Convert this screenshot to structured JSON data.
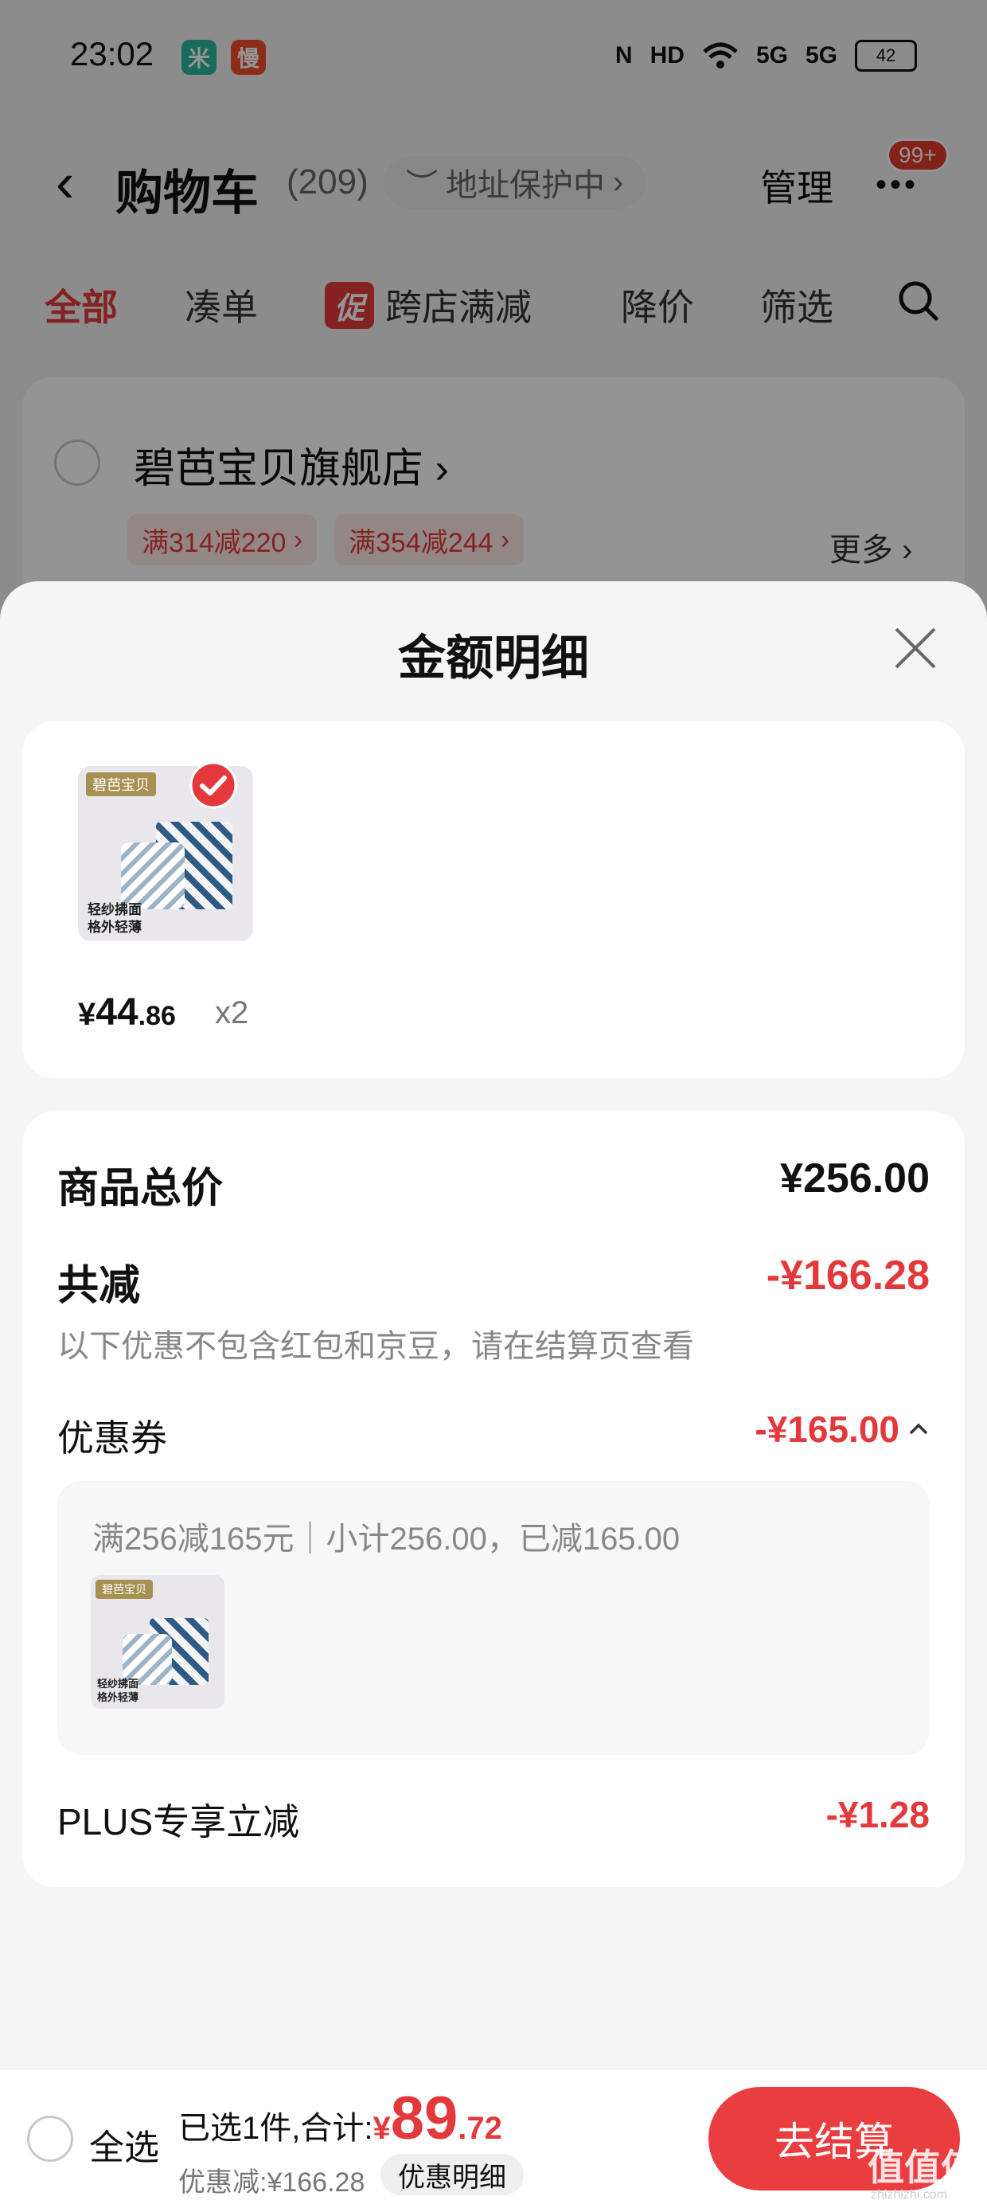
{
  "status_bar": {
    "time": "23:02",
    "app1": "米",
    "app2": "慢",
    "nfc": "N",
    "hd": "HD",
    "signal1": "5G",
    "signal2": "5G",
    "battery": "42"
  },
  "cart_header": {
    "title": "购物车",
    "count": "(209)",
    "address_protection": "地址保护中",
    "manage": "管理",
    "message_badge": "99+"
  },
  "filter_tabs": {
    "all": "全部",
    "coudan": "凑单",
    "promo_chip": "促",
    "cross_store": "跨店满减",
    "price_drop": "降价",
    "filter": "筛选"
  },
  "store": {
    "name": "碧芭宝贝旗舰店",
    "coupon1": "满314减220",
    "coupon2": "满354减244",
    "more": "更多"
  },
  "sheet": {
    "title": "金额明细",
    "product": {
      "brand": "碧芭宝贝",
      "caption_line1": "轻纱拂面",
      "caption_line2": "格外轻薄",
      "price_symbol": "¥",
      "price_int": "44",
      "price_dec": ".86",
      "quantity": "x2"
    },
    "goods_total_label": "商品总价",
    "goods_total_value": "¥256.00",
    "total_discount_label": "共减",
    "total_discount_value": "-¥166.28",
    "discount_note": "以下优惠不包含红包和京豆，请在结算页查看",
    "coupon_label": "优惠券",
    "coupon_value": "-¥165.00",
    "coupon_desc": "满256减165元｜小计256.00，已减165.00",
    "plus_label": "PLUS专享立减",
    "plus_value": "-¥1.28"
  },
  "bottom_bar": {
    "select_all": "全选",
    "selected_text": "已选1件,合计:",
    "total_symbol": "¥",
    "total_int": "89",
    "total_dec": ".72",
    "discount_line": "优惠减:¥166.28",
    "detail_link": "优惠明细",
    "checkout": "去结算"
  },
  "watermark": {
    "text": "值值值",
    "sub": "zhizhizhi.com"
  },
  "colors": {
    "accent": "#e4393c",
    "checkout": "#ea3d40"
  }
}
